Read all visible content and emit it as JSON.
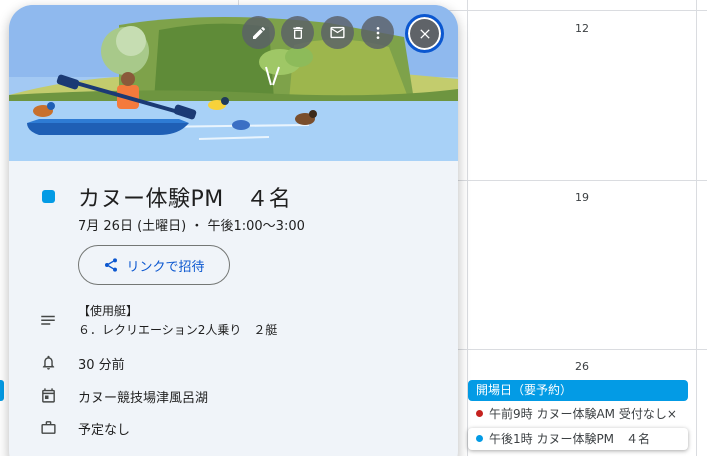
{
  "calendar": {
    "day_numbers": [
      "12",
      "19",
      "26"
    ],
    "allday_event": "開場日（要予約）",
    "events": [
      {
        "label": "午前9時 カヌー体験AM 受付なし×",
        "color": "#c5221f"
      },
      {
        "label": "午後1時 カヌー体験PM　４名",
        "color": "#039be5"
      }
    ]
  },
  "event": {
    "title": "カヌー体験PM　４名",
    "datetime": "7月 26日 (土曜日) ・ 午後1:00～3:00",
    "invite_label": "リンクで招待",
    "description_lines": [
      "【使用艇】",
      "６．レクリエーション2人乗り　２艇"
    ],
    "notification": "30 分前",
    "calendar_name": "カヌー競技場津風呂湖",
    "status": "予定なし",
    "color": "#039be5"
  },
  "toolbar": {
    "edit_icon": "pencil-icon",
    "delete_icon": "trash-icon",
    "email_icon": "mail-icon",
    "more_icon": "more-vert-icon",
    "close_icon": "close-icon"
  }
}
